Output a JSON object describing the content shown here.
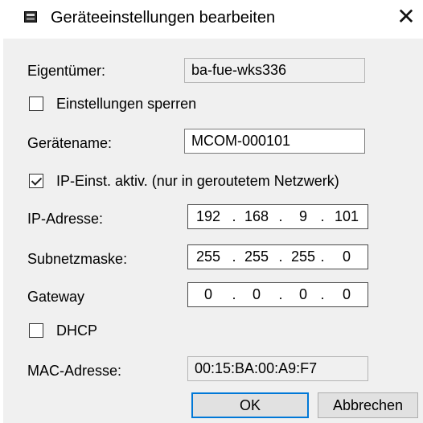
{
  "window": {
    "title": "Geräteeinstellungen bearbeiten",
    "close_glyph": "✕"
  },
  "owner": {
    "label": "Eigentümer:",
    "value": "ba-fue-wks336"
  },
  "lock_settings": {
    "label": "Einstellungen sperren",
    "checked": false
  },
  "device_name": {
    "label": "Gerätename:",
    "value": "MCOM-000101"
  },
  "ip_active": {
    "label": "IP-Einst. aktiv. (nur in geroutetem Netzwerk)",
    "checked": true
  },
  "ip_address": {
    "label": "IP-Adresse:",
    "octets": [
      "192",
      "168",
      "9",
      "101"
    ]
  },
  "subnet_mask": {
    "label": "Subnetzmaske:",
    "octets": [
      "255",
      "255",
      "255",
      "0"
    ]
  },
  "gateway": {
    "label": "Gateway",
    "octets": [
      "0",
      "0",
      "0",
      "0"
    ]
  },
  "dhcp": {
    "label": "DHCP",
    "checked": false
  },
  "mac_address": {
    "label": "MAC-Adresse:",
    "value": "00:15:BA:00:A9:F7"
  },
  "buttons": {
    "ok": "OK",
    "cancel": "Abbrechen"
  },
  "ip_separator": "."
}
